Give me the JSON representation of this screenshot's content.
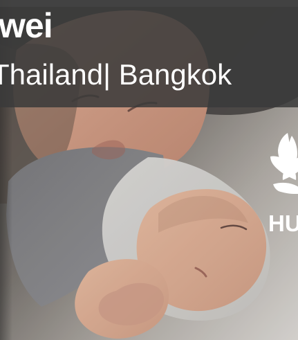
{
  "banner": {
    "title": "wei",
    "subtitle": "Thailand| Bangkok",
    "logo_text": "HU",
    "colors": {
      "overlay": "#3a3a3a",
      "text": "#ffffff"
    },
    "icons": {
      "logo": "huawei-flower-logo",
      "photo": "mother-and-baby-photo"
    }
  }
}
